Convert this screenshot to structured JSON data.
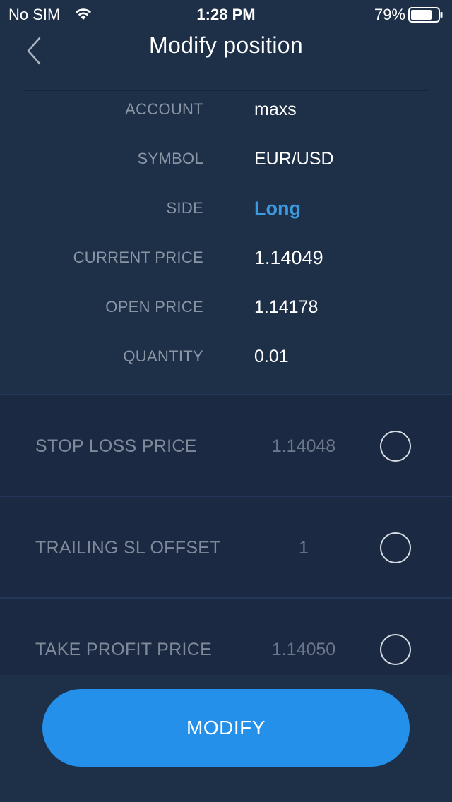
{
  "status_bar": {
    "carrier": "No SIM",
    "time": "1:28 PM",
    "battery_percent": "79%",
    "battery_level": 0.79,
    "icons": [
      "wifi-icon",
      "battery-icon"
    ]
  },
  "nav": {
    "title": "Modify position",
    "back_icon": "chevron-left-icon"
  },
  "info": {
    "account": {
      "label": "ACCOUNT",
      "value": "maxs"
    },
    "symbol": {
      "label": "SYMBOL",
      "value": "EUR/USD"
    },
    "side": {
      "label": "SIDE",
      "value": "Long"
    },
    "current_price": {
      "label": "CURRENT PRICE",
      "value": "1.14049"
    },
    "open_price": {
      "label": "OPEN PRICE",
      "value": "1.14178"
    },
    "quantity": {
      "label": "QUANTITY",
      "value": "0.01"
    }
  },
  "options": {
    "stop_loss": {
      "label": "STOP LOSS PRICE",
      "value": "1.14048",
      "selected": false
    },
    "trailing_sl": {
      "label": "TRAILING SL OFFSET",
      "value": "1",
      "selected": false
    },
    "take_profit": {
      "label": "TAKE PROFIT PRICE",
      "value": "1.14050",
      "selected": false
    }
  },
  "actions": {
    "modify_label": "MODIFY"
  },
  "colors": {
    "background": "#1e2f48",
    "options_background": "#1b2a42",
    "accent": "#2590ea",
    "side_long": "#3b9ae0",
    "label": "#8b96a5"
  }
}
